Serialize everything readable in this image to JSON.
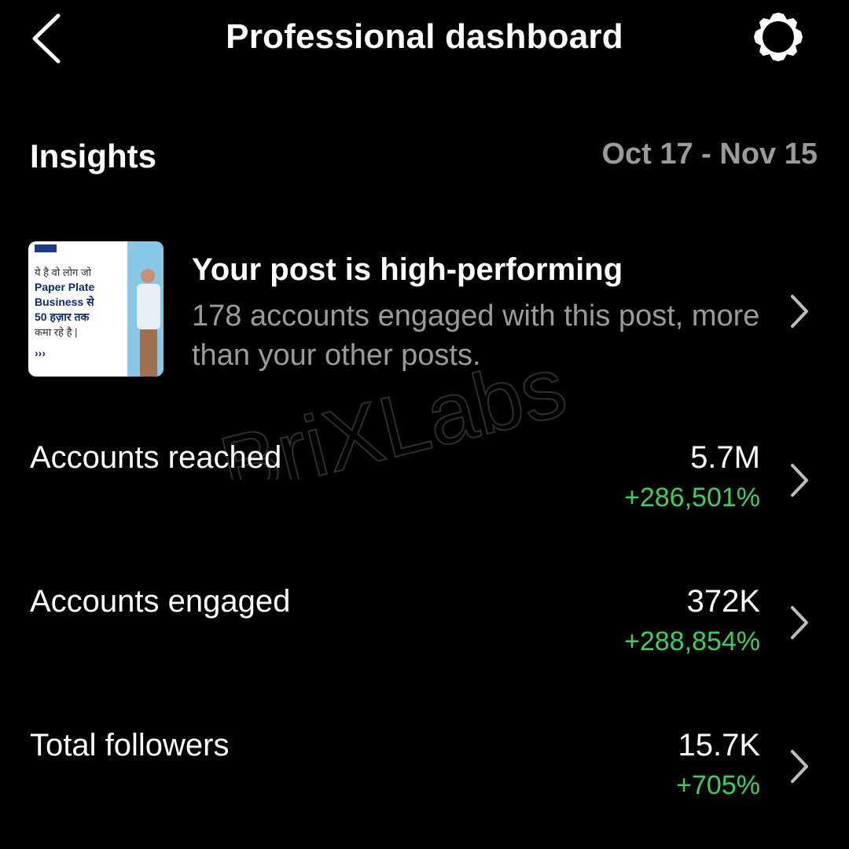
{
  "header": {
    "title": "Professional dashboard",
    "back_icon": "chevron-left-icon",
    "settings_icon": "gear-icon"
  },
  "insights": {
    "label": "Insights",
    "date_range": "Oct 17 - Nov 15"
  },
  "post_card": {
    "title": "Your post is high-performing",
    "description": "178 accounts engaged with this post, more than your other posts.",
    "thumbnail": {
      "lines": [
        "ये है वो लोग जो",
        "Paper Plate",
        "Business से",
        "50 हज़ार तक",
        "कमा रहे है |"
      ],
      "arrows": "›››"
    },
    "chevron_icon": "chevron-right-icon"
  },
  "metrics": [
    {
      "label": "Accounts reached",
      "value": "5.7M",
      "change": "+286,501%"
    },
    {
      "label": "Accounts engaged",
      "value": "372K",
      "change": "+288,854%"
    },
    {
      "label": "Total followers",
      "value": "15.7K",
      "change": "+705%"
    }
  ],
  "watermark": {
    "text": "BriXLabs"
  },
  "colors": {
    "background": "#000000",
    "primary_text": "#ffffff",
    "secondary_text": "#9a9a9a",
    "positive": "#3ad15a"
  }
}
